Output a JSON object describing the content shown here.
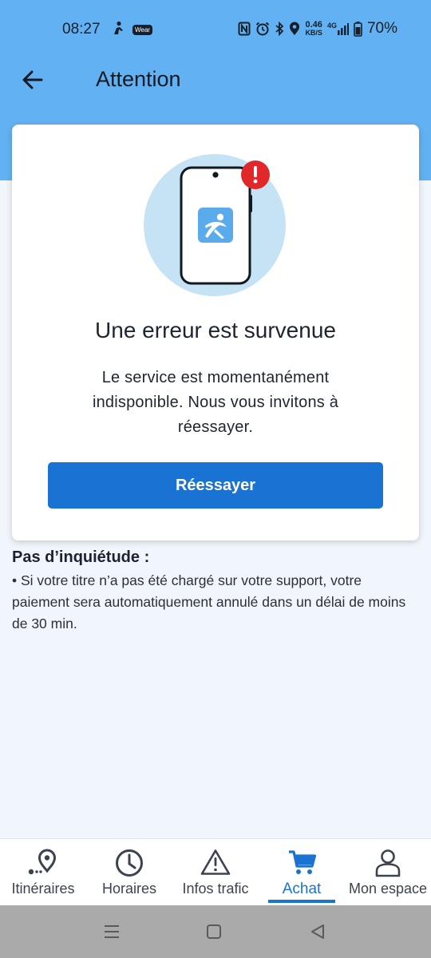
{
  "status_bar": {
    "time": "08:27",
    "wear_label": "Wear",
    "net_speed_value": "0.46",
    "net_speed_unit": "KB/S",
    "network": "4G",
    "battery": "70%"
  },
  "appbar": {
    "title": "Attention",
    "back_icon": "arrow-left-icon"
  },
  "error_card": {
    "illustration": "phone-error-illustration",
    "title": "Une erreur est survenue",
    "message": "Le service est momentanément indisponible. Nous vous invitons à réessayer.",
    "retry_label": "Réessayer"
  },
  "info": {
    "title": "Pas d’inquiétude :",
    "text": "• Si votre titre n’a pas été chargé sur votre support, votre paiement sera automatiquement annulé dans un délai de moins de 30 min."
  },
  "bottom_nav": {
    "items": [
      {
        "label": "Itinéraires",
        "icon": "route-pin-icon",
        "active": false
      },
      {
        "label": "Horaires",
        "icon": "clock-icon",
        "active": false
      },
      {
        "label": "Infos trafic",
        "icon": "warning-icon",
        "active": false
      },
      {
        "label": "Achat",
        "icon": "cart-icon",
        "active": true
      },
      {
        "label": "Mon espace",
        "icon": "user-icon",
        "active": false
      }
    ]
  },
  "colors": {
    "header": "#62b1f2",
    "accent": "#1a73d2",
    "background": "#f1f5fc",
    "alert": "#e0282a"
  }
}
